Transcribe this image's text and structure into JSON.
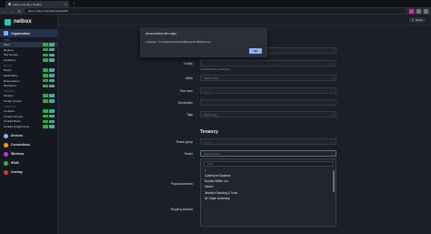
{
  "browser": {
    "tab_title": "Add a new site | NetBox",
    "url": "demo.netbox.dev/dcim/sites/add/",
    "icons": [
      "back-icon",
      "forward-icon",
      "reload-icon",
      "close-icon"
    ]
  },
  "sidebar": {
    "logo": "netbox",
    "organization": "Organization",
    "sections": [
      {
        "label": "SITES",
        "items": [
          "Sites",
          "Regions",
          "Site Groups",
          "Locations"
        ]
      },
      {
        "label": "RACKS",
        "items": [
          "Racks",
          "Rack Roles",
          "Reservations",
          "Elevations"
        ]
      },
      {
        "label": "TENANCY",
        "items": [
          "Tenants",
          "Tenant Groups"
        ]
      },
      {
        "label": "CONTACTS",
        "items": [
          "Contacts",
          "Contact Groups",
          "Contact Roles",
          "Contact Assignments"
        ]
      }
    ],
    "add_symbol": "+",
    "import_symbol": "⇪",
    "groups": [
      "Devices",
      "Connections",
      "Wireless",
      "IPAM",
      "Overlay"
    ]
  },
  "topbar": {
    "user": "admin"
  },
  "form": {
    "group_label": "Group",
    "group_value": "--------",
    "facility_label": "Facility",
    "facility_help": "Local facility ID or description",
    "asns_label": "ASNs",
    "asns_placeholder": "Select ASNs",
    "timezone_label": "Time zone",
    "timezone_value": "--------",
    "description_label": "Description",
    "tags_label": "Tags",
    "tags_placeholder": "Select tags",
    "tenancy_title": "Tenancy",
    "tenant_group_label": "Tenant group",
    "tenant_group_value": "--------",
    "tenant_label": "Tenant",
    "tenant_placeholder": "Select tenant",
    "filter_placeholder": "Filter",
    "tenant_options": [
      "Cyberdyne Systems",
      "Dunder-Mifflin, Inc.",
      "Initech",
      "Jimbob's Banking & Trust",
      "NC State University"
    ],
    "physical_address_label": "Physical address",
    "shipping_address_label": "Shipping address",
    "shipping_help": "If different from the physical address"
  },
  "dialog": {
    "title": "demo.netbox.dev says",
    "message": "csrftoken: rYk12Kp5Ck1dpXGbWdnsaz9sXfPhgzrmsu",
    "ok": "OK"
  }
}
